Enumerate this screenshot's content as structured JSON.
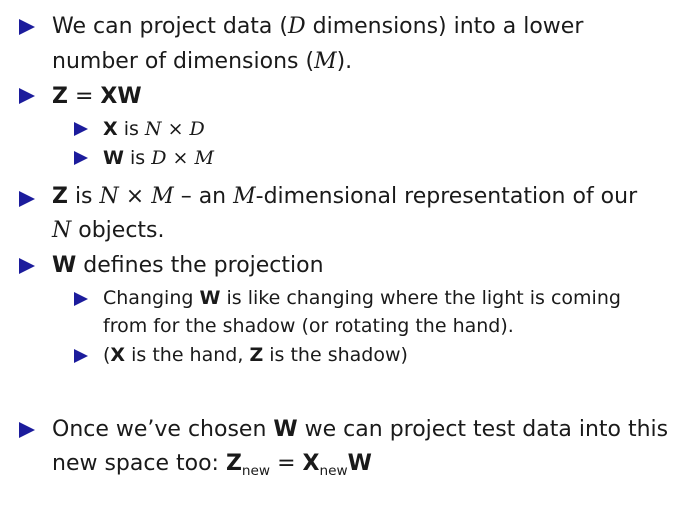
{
  "bullet_color": "#1c1c9c",
  "bullets": [
    {
      "lines": [
        "We can project data (<i>D</i> dimensions) into a lower",
        "number of dimensions (<i>M</i>)."
      ]
    },
    {
      "lines": [
        "<b>Z</b> = <b>XW</b>"
      ],
      "sub": [
        {
          "lines": [
            "<b>X</b> is <i>N</i> × <i>D</i>"
          ]
        },
        {
          "lines": [
            "<b>W</b> is <i>D</i> × <i>M</i>"
          ]
        }
      ]
    },
    {
      "lines": [
        "<b>Z</b> is <i>N</i> × <i>M</i> – an <i>M</i>-dimensional representation of our",
        "<i>N</i> objects."
      ]
    },
    {
      "lines": [
        "<b>W</b> defines the projection"
      ],
      "sub": [
        {
          "lines": [
            "Changing <b>W</b> is like changing where the light is coming",
            "from for the shadow (or rotating the hand)."
          ]
        },
        {
          "lines": [
            "(<b>X</b> is the hand, <b>Z</b> is the shadow)"
          ]
        }
      ]
    },
    {
      "lines": [
        "Once we’ve chosen <b>W</b> we can project test data into this",
        "new space too: <b>Z</b><sub>new</sub> = <b>X</b><sub>new</sub><b>W</b>"
      ]
    }
  ]
}
